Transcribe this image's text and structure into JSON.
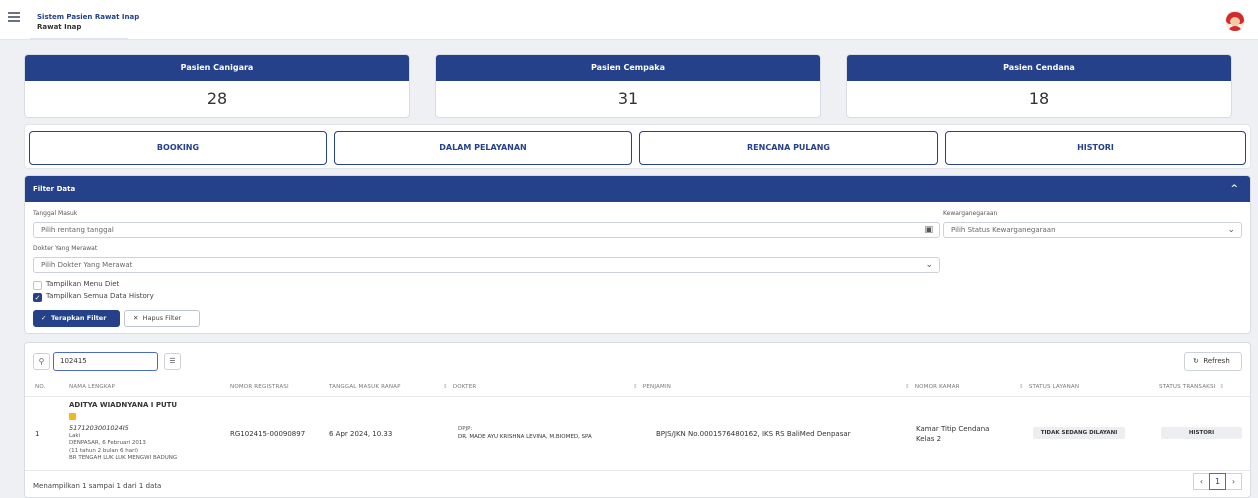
{
  "header": {
    "app_title": "Sistem Pasien Rawat Inap",
    "sub_title": "Rawat Inap"
  },
  "stats": [
    {
      "label": "Pasien Canigara",
      "value": "28"
    },
    {
      "label": "Pasien Cempaka",
      "value": "31"
    },
    {
      "label": "Pasien Cendana",
      "value": "18"
    }
  ],
  "tabs": [
    "BOOKING",
    "DALAM PELAYANAN",
    "RENCANA PULANG",
    "HISTORI"
  ],
  "filter": {
    "title": "Filter Data",
    "tanggal_label": "Tanggal Masuk",
    "tanggal_placeholder": "Pilih rentang tanggal",
    "kewarganegaraan_label": "Kewarganegaraan",
    "kewarganegaraan_placeholder": "Pilih Status Kewarganegaraan",
    "dokter_label": "Dokter Yang Merawat",
    "dokter_placeholder": "Pilih Dokter Yang Merawat",
    "menu_diet_label": "Tampilkan Menu Diet",
    "menu_diet_checked": false,
    "history_label": "Tampilkan Semua Data History",
    "history_checked": true,
    "apply_label": "Terapkan Filter",
    "clear_label": "Hapus Filter"
  },
  "table": {
    "search_value": "102415",
    "refresh_label": "Refresh",
    "columns": [
      "NO.",
      "NAMA LENGKAP",
      "NOMOR REGISTRASI",
      "TANGGAL MASUK RANAP",
      "DOKTER",
      "PENJAMIN",
      "NOMOR KAMAR",
      "STATUS LAYANAN",
      "STATUS TRANSAKSI"
    ],
    "rows": [
      {
        "no": "1",
        "name": "ADITYA WIADNYANA I PUTU",
        "nik": "5171203001024I5",
        "gender": "Laki",
        "birth": "DENPASAR, 6 Februari 2013",
        "age": "(11 tahun 2 bulan 6 hari)",
        "address": "BR TENGAH LUK LUK MENGWI BADUNG",
        "registrasi": "RG102415-00090897",
        "tanggal": "6 Apr 2024, 10.33",
        "dpjp_label": "DPJP:",
        "dokter": "DR. MADE AYU KRISHNA LEVINA, M.BIOMED, SPA",
        "penjamin": "BPJS/JKN No.0001576480162, IKS RS BaliMed Denpasar",
        "kamar": "Kamar Titip Cendana",
        "kelas": "Kelas 2",
        "status_layanan": "TIDAK SEDANG DILAYANI",
        "status_transaksi": "HISTORI"
      }
    ],
    "footer_info": "Menampilkan 1 sampai 1 dari 1 data",
    "current_page": "1"
  },
  "icons": {
    "hamburger": "hamburger-icon",
    "calendar": "calendar-icon",
    "chevron": "chevron-down-icon",
    "check": "check-icon",
    "close": "close-icon",
    "search": "search-icon",
    "refresh": "refresh-icon"
  },
  "colors": {
    "primary": "#24418a",
    "accent_flag": "#f3b61f",
    "avatar": "#d22b2b"
  }
}
